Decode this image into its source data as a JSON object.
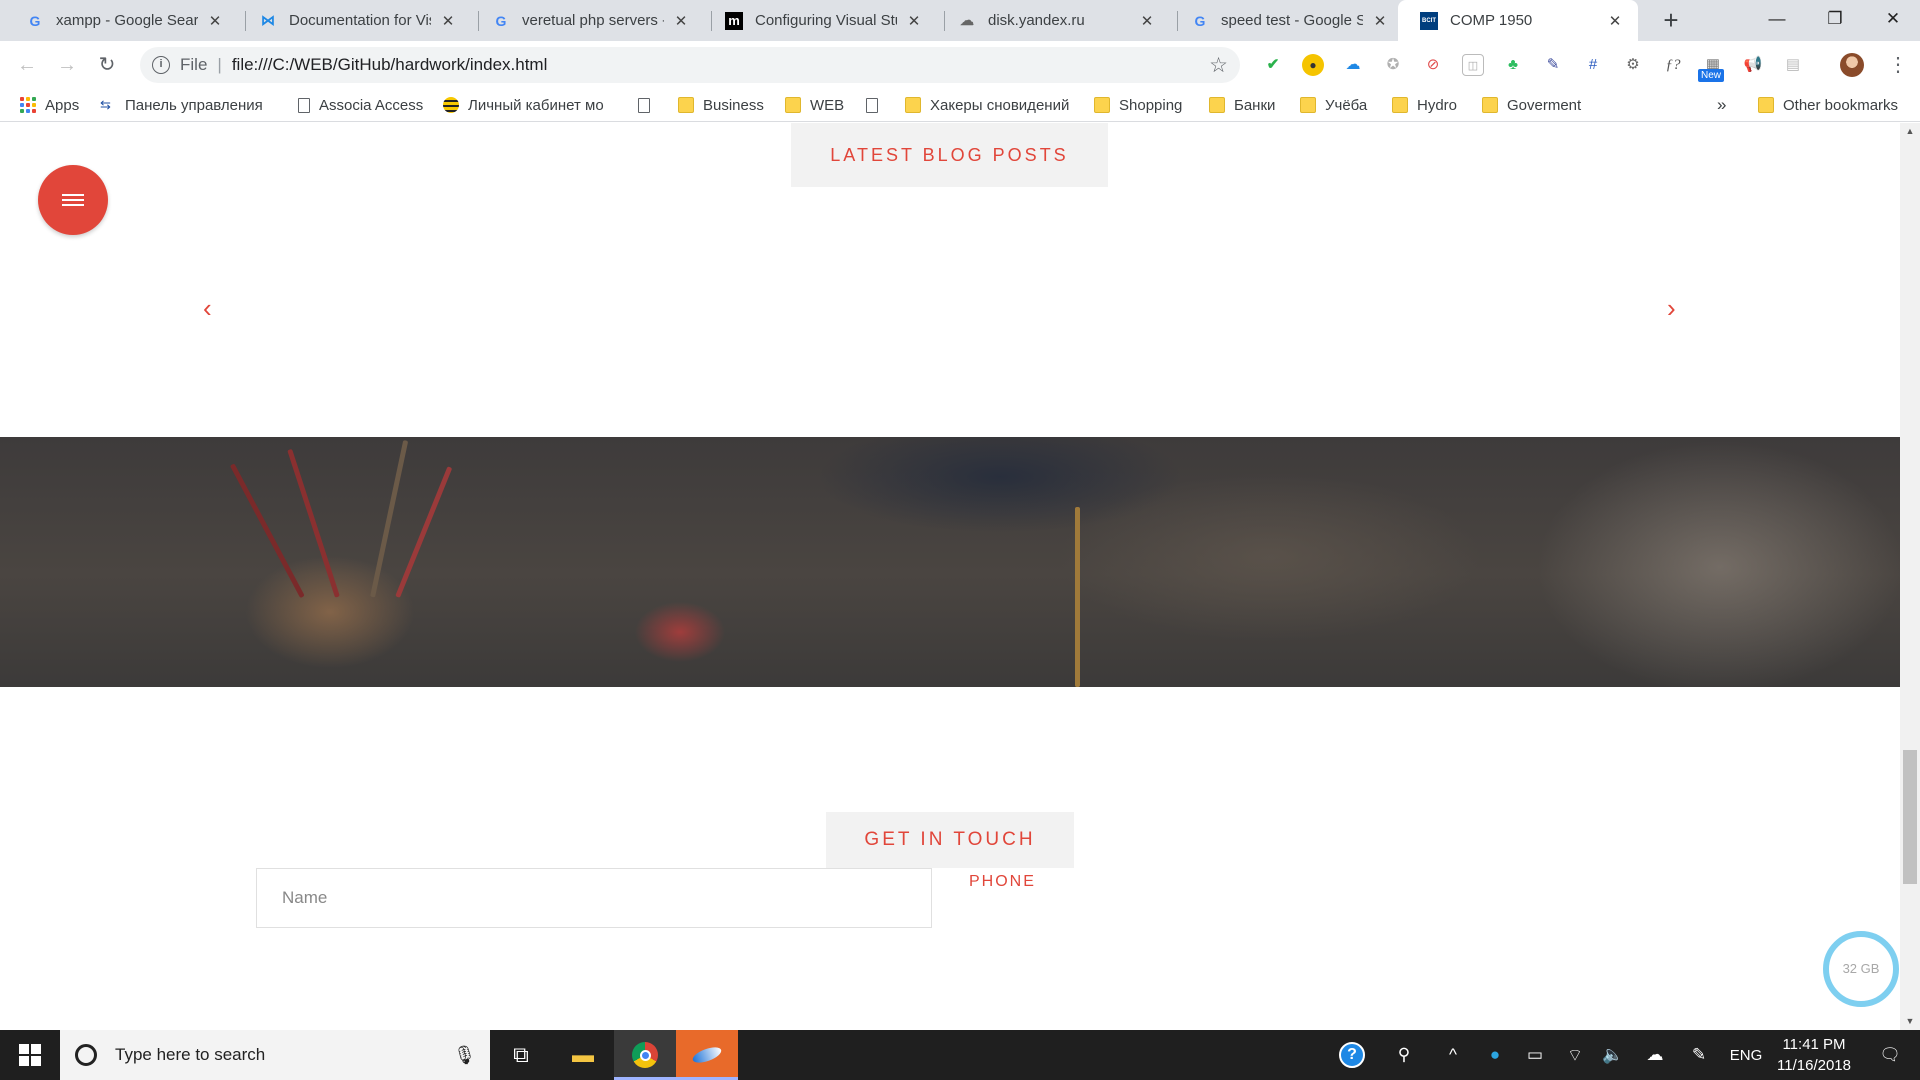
{
  "tabs": [
    {
      "title": "xampp - Google Search",
      "icon": "google-icon"
    },
    {
      "title": "Documentation for Visual Studio Code",
      "icon": "vscode-icon"
    },
    {
      "title": "veretual php servers - Google Search",
      "icon": "google-icon"
    },
    {
      "title": "Configuring Visual Studio Code",
      "icon": "medium-icon"
    },
    {
      "title": "disk.yandex.ru",
      "icon": "yandex-disk-icon"
    },
    {
      "title": "speed test - Google Search",
      "icon": "google-icon"
    },
    {
      "title": "COMP 1950",
      "icon": "bcit-icon",
      "favicon_text": "BCIT",
      "active": true
    }
  ],
  "address_bar": {
    "scheme_label": "File",
    "url": "file:///C:/WEB/GitHub/hardwork/index.html"
  },
  "extensions_new_badge": "New",
  "bookmarks": [
    {
      "label": "Apps",
      "icon": "apps-grid-icon"
    },
    {
      "label": "Панель управления",
      "icon": "control-panel-icon"
    },
    {
      "label": "Associa Access",
      "icon": "page-icon"
    },
    {
      "label": "Личный кабинет мо",
      "icon": "beeline-icon"
    },
    {
      "label": "",
      "icon": "page-icon"
    },
    {
      "label": "Business",
      "icon": "folder-icon"
    },
    {
      "label": "WEB",
      "icon": "folder-icon"
    },
    {
      "label": "",
      "icon": "page-icon"
    },
    {
      "label": "Хакеры сновидений",
      "icon": "folder-icon"
    },
    {
      "label": "Shopping",
      "icon": "folder-icon"
    },
    {
      "label": "Банки",
      "icon": "folder-icon"
    },
    {
      "label": "Учёба",
      "icon": "folder-icon"
    },
    {
      "label": "Hydro",
      "icon": "folder-icon"
    },
    {
      "label": "Goverment",
      "icon": "folder-icon"
    }
  ],
  "bookmarks_overflow": "»",
  "other_bookmarks": "Other bookmarks",
  "page": {
    "blog_heading": "LATEST BLOG POSTS",
    "contact_heading": "GET IN TOUCH",
    "name_placeholder": "Name",
    "phone_label": "PHONE",
    "storage_badge": "32 GB"
  },
  "colors": {
    "accent": "#e1463a",
    "tag_bg": "#f2f2f2",
    "storage_ring": "#7ecff0"
  },
  "taskbar": {
    "search_placeholder": "Type here to search",
    "language": "ENG",
    "time": "11:41 PM",
    "date": "11/16/2018"
  }
}
